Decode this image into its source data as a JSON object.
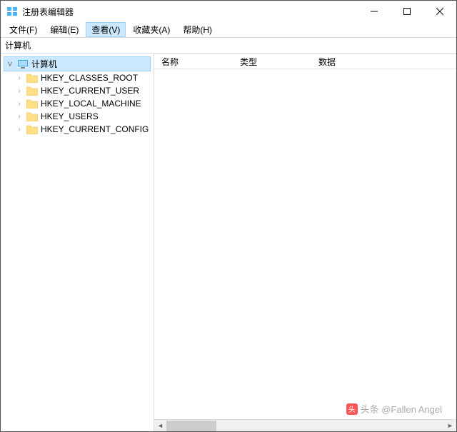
{
  "window": {
    "title": "注册表编辑器"
  },
  "menu": {
    "file": "文件(F)",
    "edit": "编辑(E)",
    "view": "查看(V)",
    "favorites": "收藏夹(A)",
    "help": "帮助(H)"
  },
  "address": "计算机",
  "tree": {
    "root": "计算机",
    "items": [
      "HKEY_CLASSES_ROOT",
      "HKEY_CURRENT_USER",
      "HKEY_LOCAL_MACHINE",
      "HKEY_USERS",
      "HKEY_CURRENT_CONFIG"
    ]
  },
  "columns": {
    "name": "名称",
    "type": "类型",
    "data": "数据"
  },
  "watermark": "头条 @Fallen Angel"
}
